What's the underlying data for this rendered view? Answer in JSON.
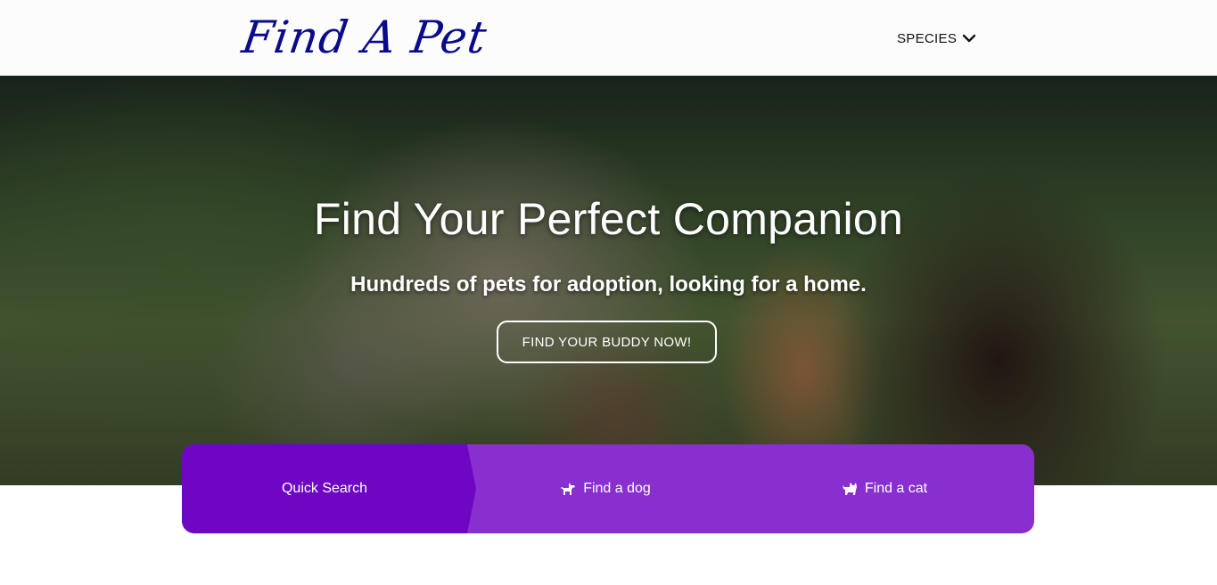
{
  "nav": {
    "logo_text": "Find A Pet",
    "species_label": "SPECIES",
    "species_icon": "chevron-down-icon"
  },
  "hero": {
    "title": "Find Your Perfect Companion",
    "subtitle": "Hundreds of pets for adoption, looking for a home.",
    "cta_label": "FIND YOUR BUDDY NOW!"
  },
  "search_bar": {
    "tabs": [
      {
        "label": "Quick Search",
        "icon": ""
      },
      {
        "label": "Find a dog",
        "icon": "dog-icon"
      },
      {
        "label": "Find a cat",
        "icon": "cat-icon"
      }
    ]
  },
  "colors": {
    "logo": "#0a0a8c",
    "tab_active": "#6f06c3",
    "tab_bar": "#8a2fcf"
  }
}
